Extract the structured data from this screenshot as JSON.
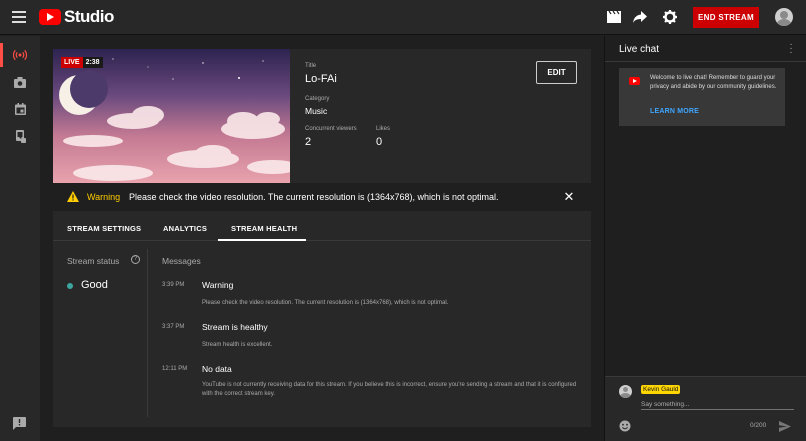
{
  "app": {
    "name": "Studio"
  },
  "topbar": {
    "end_stream_label": "END STREAM"
  },
  "stream": {
    "live_label": "LIVE",
    "elapsed": "2:38",
    "title_label": "Title",
    "title": "Lo-FAi",
    "category_label": "Category",
    "category": "Music",
    "viewers_label": "Concurrent viewers",
    "viewers": "2",
    "likes_label": "Likes",
    "likes": "0",
    "edit_label": "EDIT"
  },
  "warning": {
    "title": "Warning",
    "message": "Please check the video resolution. The current resolution is (1364x768), which is not optimal."
  },
  "tabs": [
    {
      "label": "STREAM SETTINGS"
    },
    {
      "label": "ANALYTICS"
    },
    {
      "label": "STREAM HEALTH",
      "active": true
    }
  ],
  "health": {
    "status_label": "Stream status",
    "status_value": "Good",
    "status_color": "#3ea6a0",
    "messages_label": "Messages",
    "messages": [
      {
        "time": "3:39 PM",
        "title": "Warning",
        "body": "Please check the video resolution. The current resolution is (1364x768), which is not optimal."
      },
      {
        "time": "3:37 PM",
        "title": "Stream is healthy",
        "body": "Stream health is excellent."
      },
      {
        "time": "12:11 PM",
        "title": "No data",
        "body": "YouTube is not currently receiving data for this stream. If you believe this is incorrect, ensure you're sending a stream and that it is configured with the correct stream key."
      }
    ]
  },
  "chat": {
    "title": "Live chat",
    "notice": "Welcome to live chat! Remember to guard your privacy and abide by our community guidelines.",
    "learn_more": "LEARN MORE",
    "user": "Kevin Gauld",
    "placeholder": "Say something...",
    "char_count": "0/200"
  },
  "colors": {
    "accent": "#ff0000",
    "end_stream": "#cc0000",
    "link": "#3ea6ff",
    "warning": "#ffcc00"
  }
}
